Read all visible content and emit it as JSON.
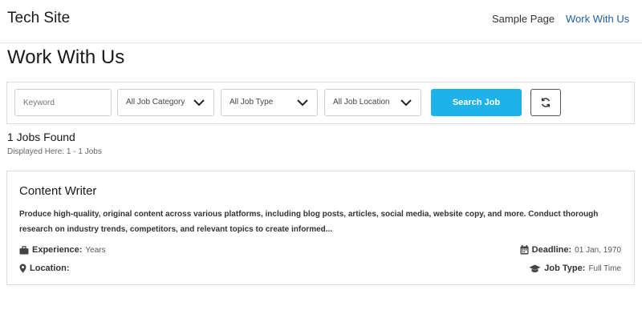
{
  "header": {
    "site_title": "Tech Site",
    "nav": [
      {
        "label": "Sample Page"
      },
      {
        "label": "Work With Us"
      }
    ],
    "active_color": "#1f5fa8"
  },
  "page": {
    "title": "Work With Us"
  },
  "search": {
    "keyword_placeholder": "Keyword",
    "category": "All Job Category",
    "job_type": "All Job Type",
    "location": "All Job Location",
    "search_label": "Search Job",
    "accent_color": "#1fb2e8"
  },
  "results": {
    "count_text": "1 Jobs Found",
    "displayed_text": "Displayed Here: 1 - 1 Jobs"
  },
  "job": {
    "title": "Content Writer",
    "description": "Produce high-quality, original content across various platforms, including blog posts, articles, social media, website copy, and more. Conduct thorough research on industry trends, competitors, and relevant topics to create informed...",
    "experience_label": "Experience:",
    "experience_value": "Years",
    "location_label": "Location:",
    "location_value": "",
    "deadline_label": "Deadline:",
    "deadline_value": "01 Jan, 1970",
    "job_type_label": "Job Type:",
    "job_type_value": "Full Time"
  }
}
